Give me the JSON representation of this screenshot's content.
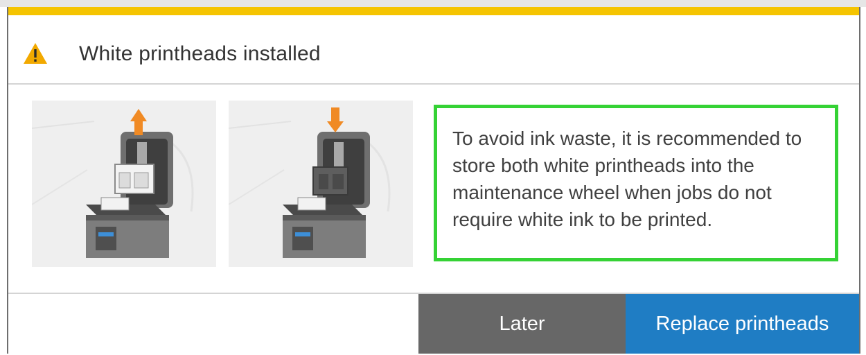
{
  "dialog": {
    "title": "White printheads installed",
    "icon": "warning-icon",
    "accent_color": "#f5c400",
    "message": "To avoid ink waste, it is recommended to store both white printheads into the maintenance wheel when jobs do not require white ink to be printed.",
    "highlight_color": "#35d235",
    "illustrations": [
      {
        "icon": "arrow-up-icon",
        "arrow_color": "#f08a24"
      },
      {
        "icon": "arrow-down-icon",
        "arrow_color": "#f08a24"
      }
    ]
  },
  "buttons": {
    "later_label": "Later",
    "later_color": "#676767",
    "replace_label": "Replace printheads",
    "replace_color": "#1f7dc4"
  }
}
